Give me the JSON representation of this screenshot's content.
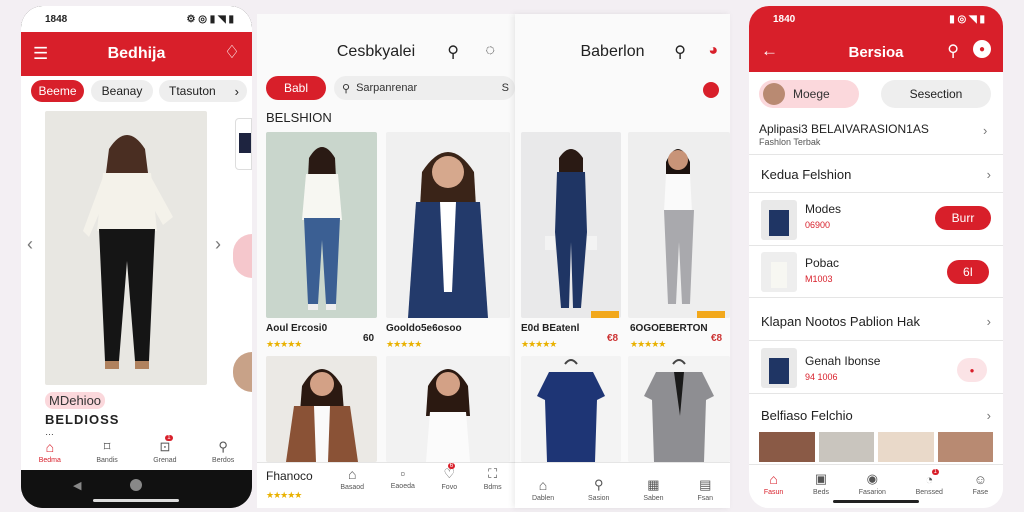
{
  "colors": {
    "brand_red": "#d81f2a",
    "page_bg": "#f3eff3",
    "chip_bg": "#eeeeee",
    "star": "#e9b100"
  },
  "screen1": {
    "status_time": "1848",
    "title": "Bedhija",
    "chips": [
      "Beeme",
      "Beanay",
      "Ttasuton"
    ],
    "product_name": "MDehioo",
    "product_sub": "BELDIOSS",
    "product_partial": "…",
    "nav": [
      "Bedma",
      "Bandis",
      "Grenad",
      "Berdos"
    ],
    "badge": "1"
  },
  "screen2": {
    "title": "Cesbkyalei",
    "chip": "Babl",
    "search_placeholder": "Sarpanrenar",
    "search_suffix": "S",
    "section": "BELSHION",
    "items": [
      {
        "name": "Aoul Ercosi0",
        "price": "60",
        "rating": "★★★★★"
      },
      {
        "name": "Gooldo5e6osoo",
        "price": "",
        "rating": "★★★★★"
      }
    ],
    "footer_name": "Fhanoco",
    "footer_rating": "★★★★★",
    "nav": [
      "Basaod",
      "Eaoeda",
      "Fovo",
      "Bdms"
    ],
    "badge": "6"
  },
  "screen3": {
    "title": "Baberlon",
    "items": [
      {
        "name": "E0d BEatenl",
        "price": "€8",
        "rating": "★★★★★"
      },
      {
        "name": "6OGOEBERTON",
        "price": "€8",
        "rating": "★★★★★"
      }
    ],
    "nav": [
      "Dablen",
      "Sasion",
      "Saben",
      "Fsan"
    ]
  },
  "screen4": {
    "status_time": "1840",
    "title": "Bersioa",
    "tab_active": "Moege",
    "tab_other": "Sesection",
    "header_line": "Aplipasi3 BELAIVARASION1AS",
    "header_sub": "Fashlon Terbak",
    "section1": "Kedua Felshion",
    "rows": [
      {
        "name": "Modes",
        "price": "06900",
        "action": "Burr"
      },
      {
        "name": "Pobac",
        "price": "M1003",
        "action": "6I"
      }
    ],
    "section2": "Klapan Nootos Pablion Hak",
    "row3": {
      "name": "Genah Ibonse",
      "price": "94 1006"
    },
    "section3": "Belfiaso Felchio",
    "nav": [
      "Fasun",
      "Beds",
      "Fasarion",
      "Benssed",
      "Fase"
    ],
    "badge": "1"
  }
}
